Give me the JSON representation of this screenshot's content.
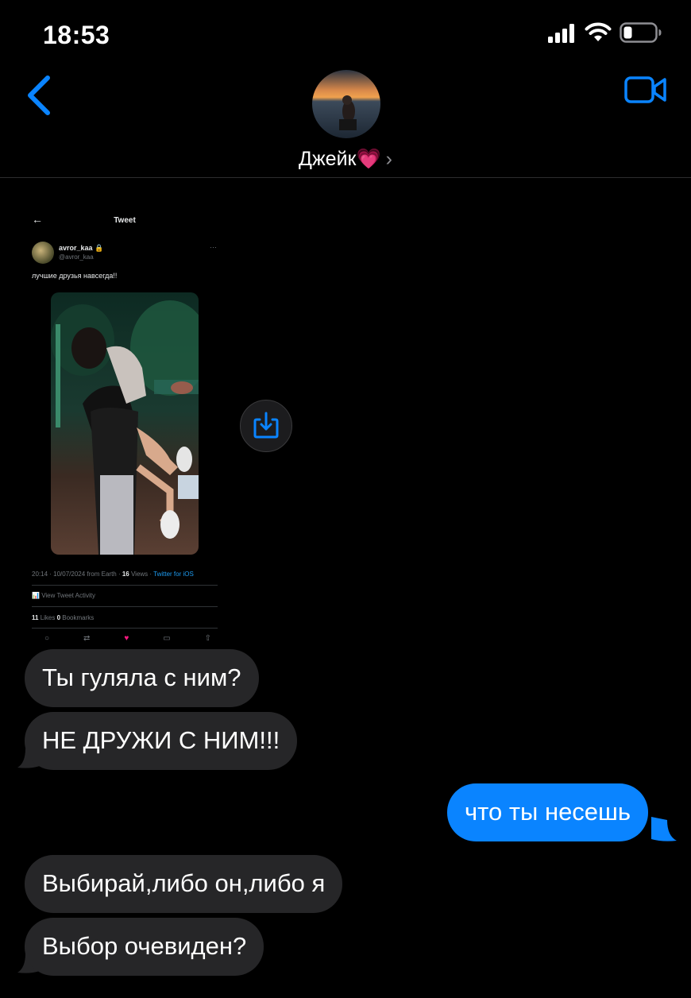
{
  "status_bar": {
    "time": "18:53"
  },
  "header": {
    "contact_name": "Джейк💗",
    "chevron": "›"
  },
  "tweet_screenshot": {
    "title": "Tweet",
    "back_arrow": "←",
    "username": "avror_kaa",
    "handle": "@avror_kaa",
    "more": "···",
    "text": "лучшие друзья навсегда!!",
    "meta_prefix": "20:14 · 10/07/2024 from Earth · ",
    "views_count": "16",
    "views_label": " Views · ",
    "client": "Twitter for iOS",
    "activity": "View Tweet Activity",
    "likes_count": "11",
    "likes_label": " Likes   ",
    "bookmarks_count": "0",
    "bookmarks_label": " Bookmarks"
  },
  "messages": [
    {
      "text": "Ты гуляла с ним?",
      "direction": "incoming"
    },
    {
      "text": "НЕ ДРУЖИ С НИМ!!!",
      "direction": "incoming"
    },
    {
      "text": "что ты несешь",
      "direction": "outgoing"
    },
    {
      "text": "Выбирай,либо он,либо я",
      "direction": "incoming"
    },
    {
      "text": "Выбор очевиден?",
      "direction": "incoming"
    }
  ],
  "colors": {
    "outgoing_bubble": "#0a84ff",
    "incoming_bubble": "#262628",
    "accent": "#0a84ff",
    "background": "#000000"
  },
  "icons": [
    "signal-icon",
    "wifi-icon",
    "battery-icon",
    "back-chevron-icon",
    "video-call-icon",
    "share-download-icon"
  ]
}
